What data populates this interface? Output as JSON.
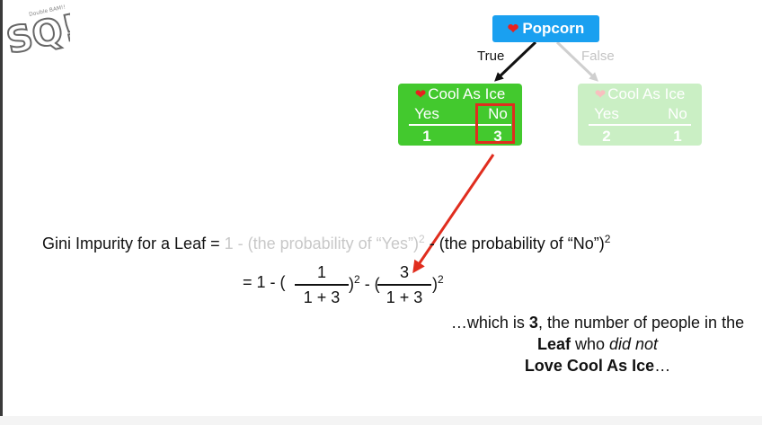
{
  "logo": {
    "text": "SQ!",
    "tag": "Double BAM!!"
  },
  "tree": {
    "root": {
      "icon": "heart-icon",
      "label": "Popcorn"
    },
    "branch_true": "True",
    "branch_false": "False",
    "left_leaf": {
      "icon": "heart-icon",
      "title": "Cool As Ice",
      "col_yes": "Yes",
      "col_no": "No",
      "yes_count": "1",
      "no_count": "3"
    },
    "right_leaf": {
      "icon": "heart-icon",
      "title": "Cool As Ice",
      "col_yes": "Yes",
      "col_no": "No",
      "yes_count": "2",
      "no_count": "1"
    }
  },
  "formula": {
    "lhs": "Gini Impurity for a Leaf = ",
    "term1": "1 - (the probability of “Yes”)",
    "term1_exp": "2",
    "term2": " - (the probability of “No”)",
    "term2_exp": "2",
    "line2_prefix": "= 1 - (",
    "frac1_num": "1",
    "frac1_den": "1 + 3",
    "mid": ")",
    "mid_exp": "2",
    "minus_paren": " - (",
    "frac2_num": "3",
    "frac2_den": "1 + 3",
    "end": ")",
    "end_exp": "2"
  },
  "explanation": {
    "p1": "…which is ",
    "bold1": "3",
    "p2": ", the number of people in the ",
    "bold2": "Leaf",
    "p3": " who ",
    "ital": "did not",
    "bold3": "Love Cool As Ice",
    "p4": "…"
  },
  "colors": {
    "root": "#1aa0f0",
    "leaf": "#43c92e",
    "highlight": "#e02d1e",
    "faded": "#c8c8c8"
  }
}
